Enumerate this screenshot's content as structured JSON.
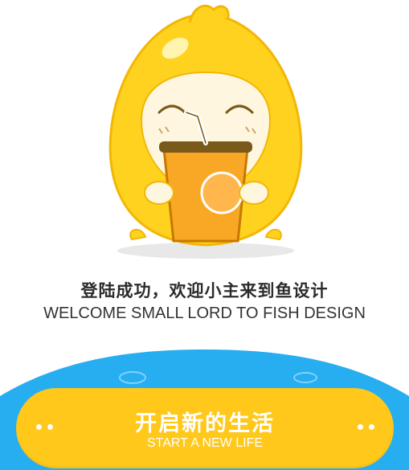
{
  "welcome": {
    "title_cn": "登陆成功，欢迎小主来到鱼设计",
    "title_en": "WELCOME SMALL LORD TO FISH DESIGN"
  },
  "cta": {
    "label_cn": "开启新的生活",
    "label_en": "START A NEW LIFE"
  },
  "colors": {
    "mascot_yellow": "#ffd21f",
    "button_yellow": "#ffc81a",
    "wave_blue": "#27aef0",
    "text_dark": "#2b2b2b"
  },
  "icons": {
    "mascot": "chick-mascot-drinking-juice-icon",
    "left_dots": "two-dots-icon",
    "right_dots": "two-dots-icon"
  }
}
